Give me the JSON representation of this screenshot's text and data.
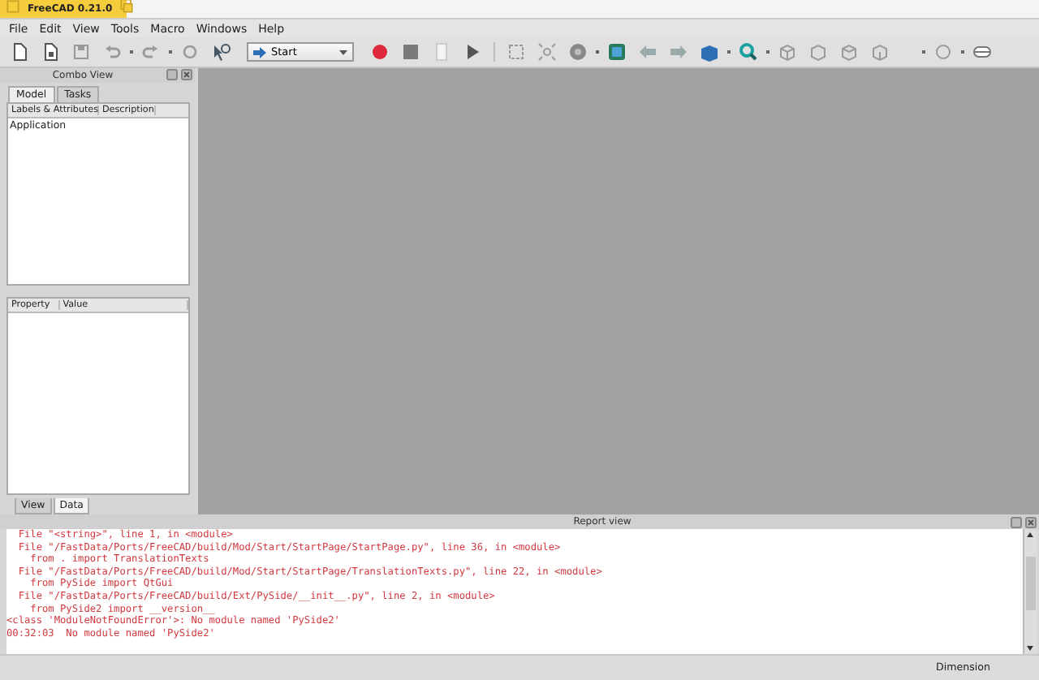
{
  "window": {
    "title": "FreeCAD 0.21.0"
  },
  "menu": [
    "File",
    "Edit",
    "View",
    "Tools",
    "Macro",
    "Windows",
    "Help"
  ],
  "toolbar": {
    "workbench": "Start"
  },
  "combo_view": {
    "title": "Combo View",
    "tabs": [
      {
        "label": "Model",
        "selected": true
      },
      {
        "label": "Tasks",
        "selected": false
      }
    ],
    "tree": {
      "columns": [
        "Labels & Attributes",
        "Description"
      ],
      "rows": [
        "Application"
      ]
    },
    "property_view": {
      "columns": [
        "Property",
        "Value"
      ]
    },
    "bottom_tabs": [
      {
        "label": "View",
        "selected": false
      },
      {
        "label": "Data",
        "selected": true
      }
    ]
  },
  "report_view": {
    "title": "Report view",
    "lines": [
      "  File \"<string>\", line 1, in <module>",
      "  File \"/FastData/Ports/FreeCAD/build/Mod/Start/StartPage/StartPage.py\", line 36, in <module>",
      "    from . import TranslationTexts",
      "  File \"/FastData/Ports/FreeCAD/build/Mod/Start/StartPage/TranslationTexts.py\", line 22, in <module>",
      "    from PySide import QtGui",
      "  File \"/FastData/Ports/FreeCAD/build/Ext/PySide/__init__.py\", line 2, in <module>",
      "    from PySide2 import __version__",
      "<class 'ModuleNotFoundError'>: No module named 'PySide2'",
      "00:32:03  No module named 'PySide2'"
    ]
  },
  "status_bar": {
    "unit": "Dimension"
  }
}
